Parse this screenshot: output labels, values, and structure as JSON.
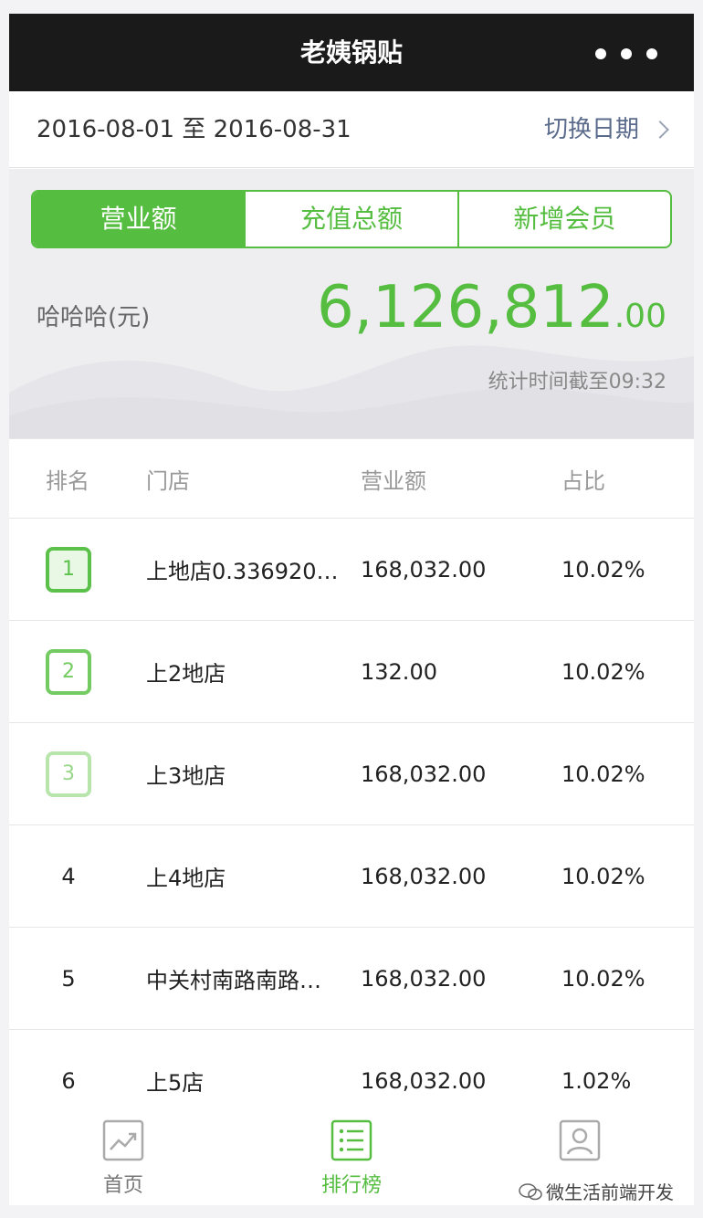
{
  "header": {
    "title": "老姨锅贴"
  },
  "datebar": {
    "range": "2016-08-01 至 2016-08-31",
    "switch_label": "切换日期"
  },
  "tabs": [
    {
      "label": "营业额",
      "active": true
    },
    {
      "label": "充值总额",
      "active": false
    },
    {
      "label": "新增会员",
      "active": false
    }
  ],
  "summary": {
    "label": "哈哈哈(元)",
    "value_int": "6,126,812",
    "value_dec": ".00",
    "stat_time": "统计时间截至09:32"
  },
  "table": {
    "headers": {
      "rank": "排名",
      "store": "门店",
      "revenue": "营业额",
      "share": "占比"
    },
    "rows": [
      {
        "rank": "1",
        "store": "上地店0.336920…",
        "revenue": "168,032.00",
        "share": "10.02%"
      },
      {
        "rank": "2",
        "store": "上2地店",
        "revenue": "132.00",
        "share": "10.02%"
      },
      {
        "rank": "3",
        "store": "上3地店",
        "revenue": "168,032.00",
        "share": "10.02%"
      },
      {
        "rank": "4",
        "store": "上4地店",
        "revenue": "168,032.00",
        "share": "10.02%"
      },
      {
        "rank": "5",
        "store": "中关村南路南路…",
        "revenue": "168,032.00",
        "share": "10.02%"
      },
      {
        "rank": "6",
        "store": "上5店",
        "revenue": "168,032.00",
        "share": "1.02%"
      }
    ]
  },
  "tabbar": {
    "home": "首页",
    "ranking": "排行榜",
    "profile": "我的"
  },
  "watermark": "微生活前端开发",
  "colors": {
    "accent": "#55bd3f",
    "titlebar": "#1a1a1a",
    "link": "#5a6b8c"
  }
}
